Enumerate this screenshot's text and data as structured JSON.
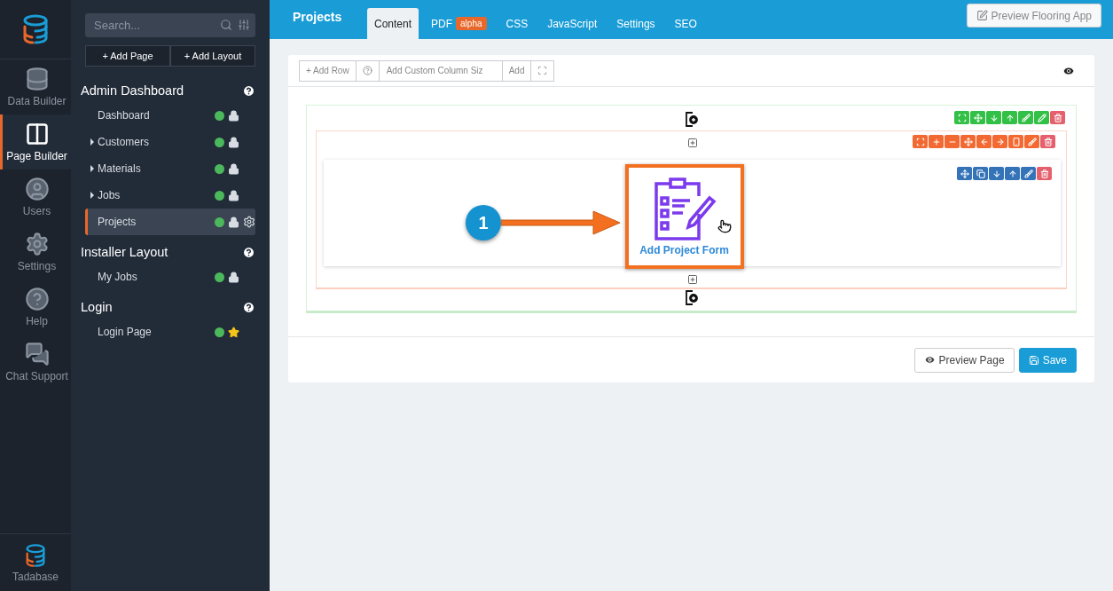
{
  "rail": {
    "items": [
      {
        "label": "Data Builder",
        "kind": "database",
        "selected": false
      },
      {
        "label": "Page Builder",
        "kind": "layout",
        "selected": true
      },
      {
        "label": "Users",
        "kind": "user",
        "selected": false
      },
      {
        "label": "Settings",
        "kind": "gears",
        "selected": false
      },
      {
        "label": "Help",
        "kind": "help",
        "selected": false
      },
      {
        "label": "Chat Support",
        "kind": "chat",
        "selected": false
      }
    ],
    "footer": "Tadabase"
  },
  "sidebar": {
    "search": {
      "placeholder": "Search..."
    },
    "buttons": [
      "+ Add Page",
      "+ Add Layout"
    ],
    "groups": [
      {
        "title": "Admin Dashboard",
        "items": [
          {
            "label": "Dashboard",
            "kind": "lock",
            "selected": false
          },
          {
            "label": "Customers",
            "kind": "lock",
            "expanded": false,
            "selected": false
          },
          {
            "label": "Materials",
            "kind": "lock",
            "expanded": false,
            "selected": false
          },
          {
            "label": "Jobs",
            "kind": "lock",
            "expanded": false,
            "selected": false
          },
          {
            "label": "Projects",
            "kind": "lock",
            "selected": true
          }
        ]
      },
      {
        "title": "Installer Layout",
        "items": [
          {
            "label": "My Jobs",
            "kind": "lock",
            "selected": false
          }
        ]
      },
      {
        "title": "Login",
        "items": [
          {
            "label": "Login Page",
            "kind": "star",
            "selected": false
          }
        ]
      }
    ]
  },
  "header": {
    "title": "Projects",
    "tabs": [
      {
        "label": "Content",
        "selected": true
      },
      {
        "label": "PDF",
        "badge": "alpha",
        "selected": false
      },
      {
        "label": "CSS",
        "selected": false
      },
      {
        "label": "JavaScript",
        "selected": false
      },
      {
        "label": "Settings",
        "selected": false
      },
      {
        "label": "SEO",
        "selected": false
      }
    ],
    "preview_button": "Preview Flooring App"
  },
  "editor": {
    "toolbar": {
      "add_row": "+ Add Row",
      "column_size": {
        "placeholder": "Add Custom Column Siz"
      },
      "add": "Add"
    },
    "component": {
      "label": "Add Project Form",
      "callout": "1"
    },
    "buttons": {
      "preview": "Preview Page",
      "save": "Save"
    }
  }
}
